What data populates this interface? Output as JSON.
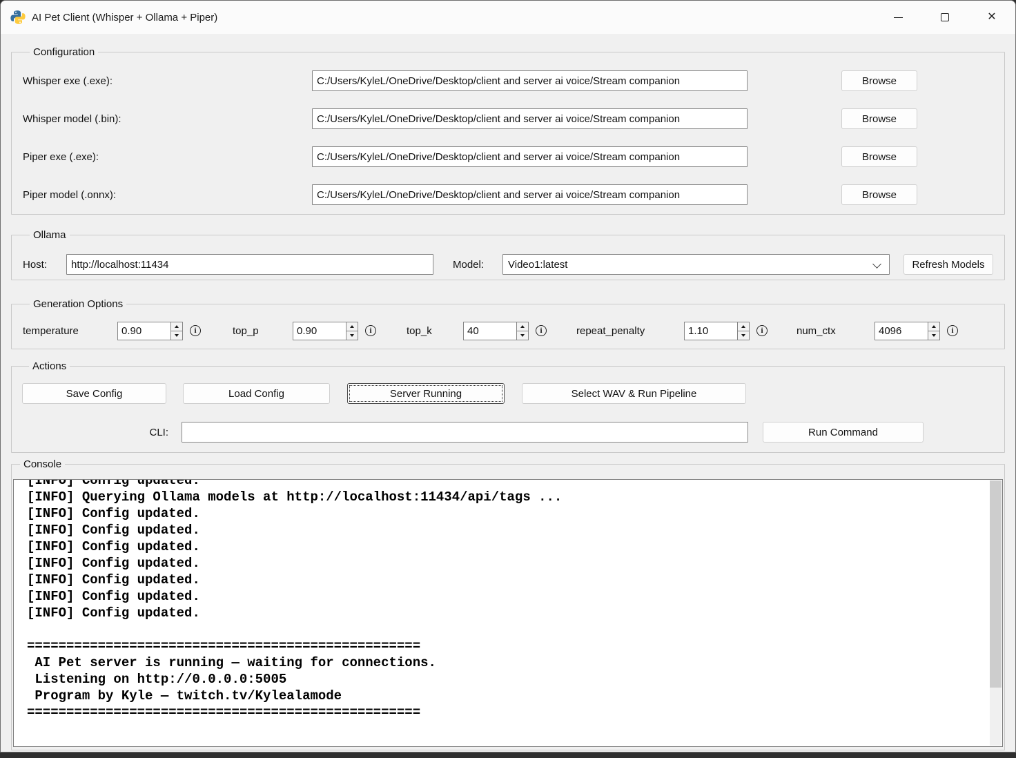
{
  "window": {
    "title": "AI Pet Client (Whisper + Ollama + Piper)"
  },
  "icons": {
    "close": "✕",
    "info": "i"
  },
  "configuration": {
    "legend": "Configuration",
    "rows": [
      {
        "label": "Whisper exe (.exe):",
        "value": "C:/Users/KyleL/OneDrive/Desktop/client and server ai voice/Stream companion",
        "browse": "Browse"
      },
      {
        "label": "Whisper model (.bin):",
        "value": "C:/Users/KyleL/OneDrive/Desktop/client and server ai voice/Stream companion",
        "browse": "Browse"
      },
      {
        "label": "Piper exe (.exe):",
        "value": "C:/Users/KyleL/OneDrive/Desktop/client and server ai voice/Stream companion",
        "browse": "Browse"
      },
      {
        "label": "Piper model (.onnx):",
        "value": "C:/Users/KyleL/OneDrive/Desktop/client and server ai voice/Stream companion",
        "browse": "Browse"
      }
    ]
  },
  "ollama": {
    "legend": "Ollama",
    "host_label": "Host:",
    "host_value": "http://localhost:11434",
    "model_label": "Model:",
    "model_value": "Video1:latest",
    "refresh_button": "Refresh Models"
  },
  "generation": {
    "legend": "Generation Options",
    "params": [
      {
        "label": "temperature",
        "value": "0.90"
      },
      {
        "label": "top_p",
        "value": "0.90"
      },
      {
        "label": "top_k",
        "value": "40"
      },
      {
        "label": "repeat_penalty",
        "value": "1.10"
      },
      {
        "label": "num_ctx",
        "value": "4096"
      }
    ]
  },
  "actions": {
    "legend": "Actions",
    "save_button": "Save Config",
    "load_button": "Load Config",
    "server_button": "Server Running",
    "pipeline_button": "Select WAV & Run Pipeline",
    "cli_label": "CLI:",
    "cli_value": "",
    "run_button": "Run Command"
  },
  "console": {
    "legend": "Console",
    "lines": [
      "[INFO] Config updated.",
      "[INFO] Querying Ollama models at http://localhost:11434/api/tags ...",
      "[INFO] Config updated.",
      "[INFO] Config updated.",
      "[INFO] Config updated.",
      "[INFO] Config updated.",
      "[INFO] Config updated.",
      "[INFO] Config updated.",
      "[INFO] Config updated.",
      "",
      "==================================================",
      " AI Pet server is running — waiting for connections.",
      " Listening on http://0.0.0.0:5005",
      " Program by Kyle — twitch.tv/Kylealamode",
      "=================================================="
    ]
  }
}
